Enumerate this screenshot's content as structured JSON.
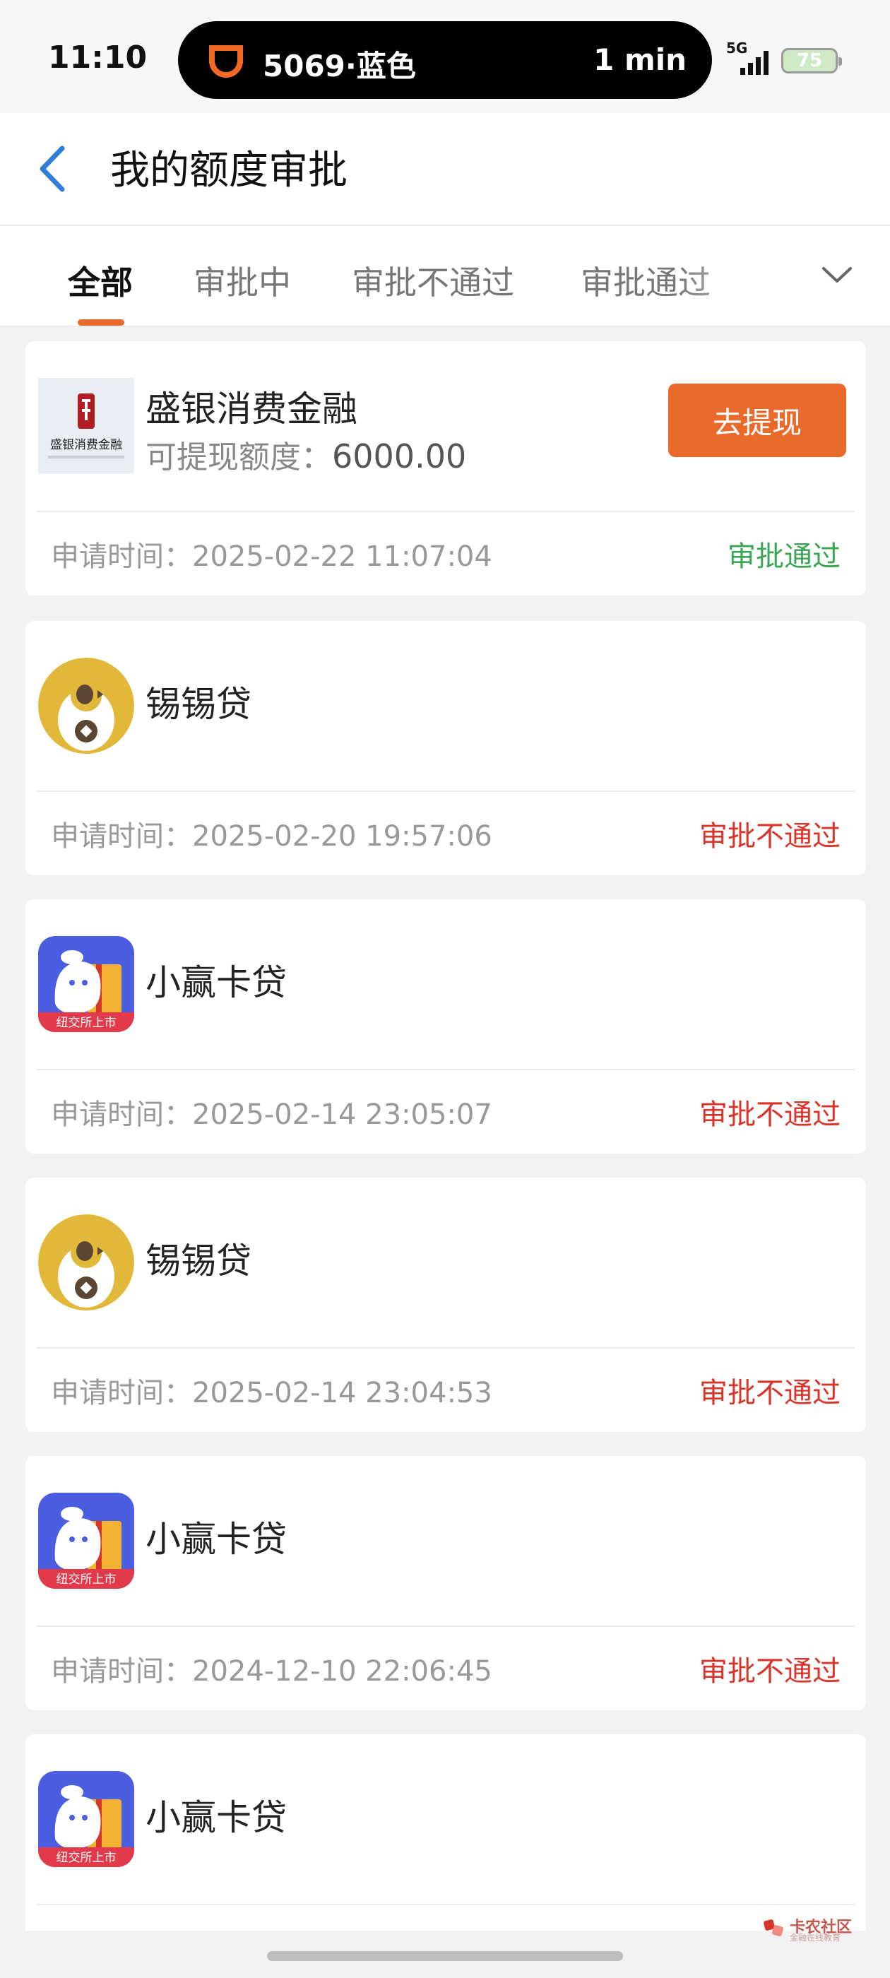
{
  "status_bar": {
    "time": "11:10",
    "island": {
      "plate": "5069·蓝色",
      "eta": "1 min"
    },
    "network": "5G",
    "battery": "75"
  },
  "header": {
    "title": "我的额度审批"
  },
  "tabs": [
    {
      "label": "全部",
      "active": true
    },
    {
      "label": "审批中",
      "active": false
    },
    {
      "label": "审批不通过",
      "active": false
    },
    {
      "label": "审批通过",
      "active": false
    }
  ],
  "colors": {
    "accent": "#ea6a2c",
    "approved": "#3aa655",
    "rejected": "#d8352a"
  },
  "labels": {
    "apply_time_prefix": "申请时间：",
    "quota_prefix": "可提现额度：",
    "withdraw": "去提现"
  },
  "applications": [
    {
      "name": "盛银消费金融",
      "logo": "shengyin-logo",
      "logo_text": "盛银消费金融",
      "quota": "6000.00",
      "apply_time": "2025-02-22 11:07:04",
      "status": "审批通过",
      "status_type": "approved"
    },
    {
      "name": "锡锡贷",
      "logo": "xixidai-logo",
      "apply_time": "2025-02-20 19:57:06",
      "status": "审批不通过",
      "status_type": "rejected"
    },
    {
      "name": "小赢卡贷",
      "logo": "xiaoying-logo",
      "logo_badge": "纽交所上市",
      "apply_time": "2025-02-14 23:05:07",
      "status": "审批不通过",
      "status_type": "rejected"
    },
    {
      "name": "锡锡贷",
      "logo": "xixidai-logo",
      "apply_time": "2025-02-14 23:04:53",
      "status": "审批不通过",
      "status_type": "rejected"
    },
    {
      "name": "小赢卡贷",
      "logo": "xiaoying-logo",
      "logo_badge": "纽交所上市",
      "apply_time": "2024-12-10 22:06:45",
      "status": "审批不通过",
      "status_type": "rejected"
    },
    {
      "name": "小赢卡贷",
      "logo": "xiaoying-logo",
      "logo_badge": "纽交所上市"
    }
  ],
  "watermark": {
    "text": "卡农社区",
    "sub": "金融在线教育"
  }
}
